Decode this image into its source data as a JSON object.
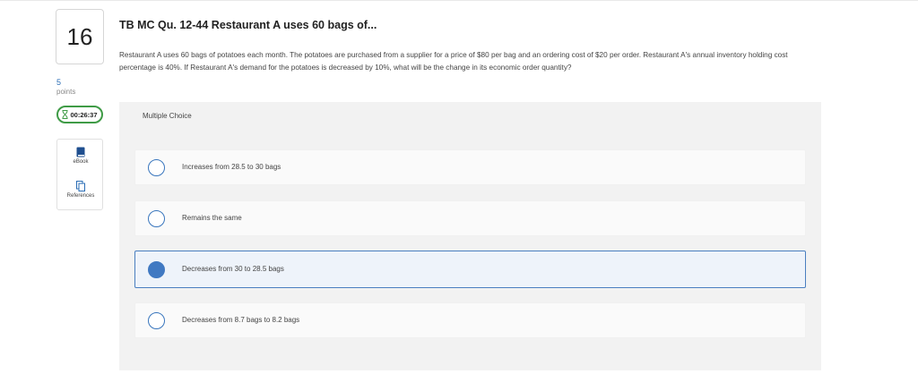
{
  "question": {
    "number": "16",
    "points_value": "5",
    "points_label": "points",
    "title": "TB MC Qu. 12-44 Restaurant A uses 60 bags of...",
    "text": "Restaurant A uses 60 bags of potatoes each month. The potatoes are purchased from a supplier for a price of $80 per bag and an ordering cost of $20 per order. Restaurant A's annual inventory holding cost percentage is 40%. If Restaurant A's demand for the potatoes is decreased by 10%, what will be the change in its economic order quantity?",
    "type_label": "Multiple Choice"
  },
  "timer": {
    "value": "00:26:37",
    "icon": "hourglass-icon",
    "color": "#3f9b46"
  },
  "tools": [
    {
      "label": "eBook",
      "icon": "book-icon"
    },
    {
      "label": "References",
      "icon": "copy-icon"
    }
  ],
  "choices": [
    {
      "text": "Increases from 28.5 to 30 bags",
      "selected": false
    },
    {
      "text": "Remains the same",
      "selected": false
    },
    {
      "text": "Decreases from 30 to 28.5 bags",
      "selected": true
    },
    {
      "text": "Decreases from 8.7 bags to 8.2 bags",
      "selected": false
    }
  ],
  "colors": {
    "accent": "#4079c2",
    "selected_bg": "#eef3fa",
    "panel_bg": "#f2f2f2"
  }
}
